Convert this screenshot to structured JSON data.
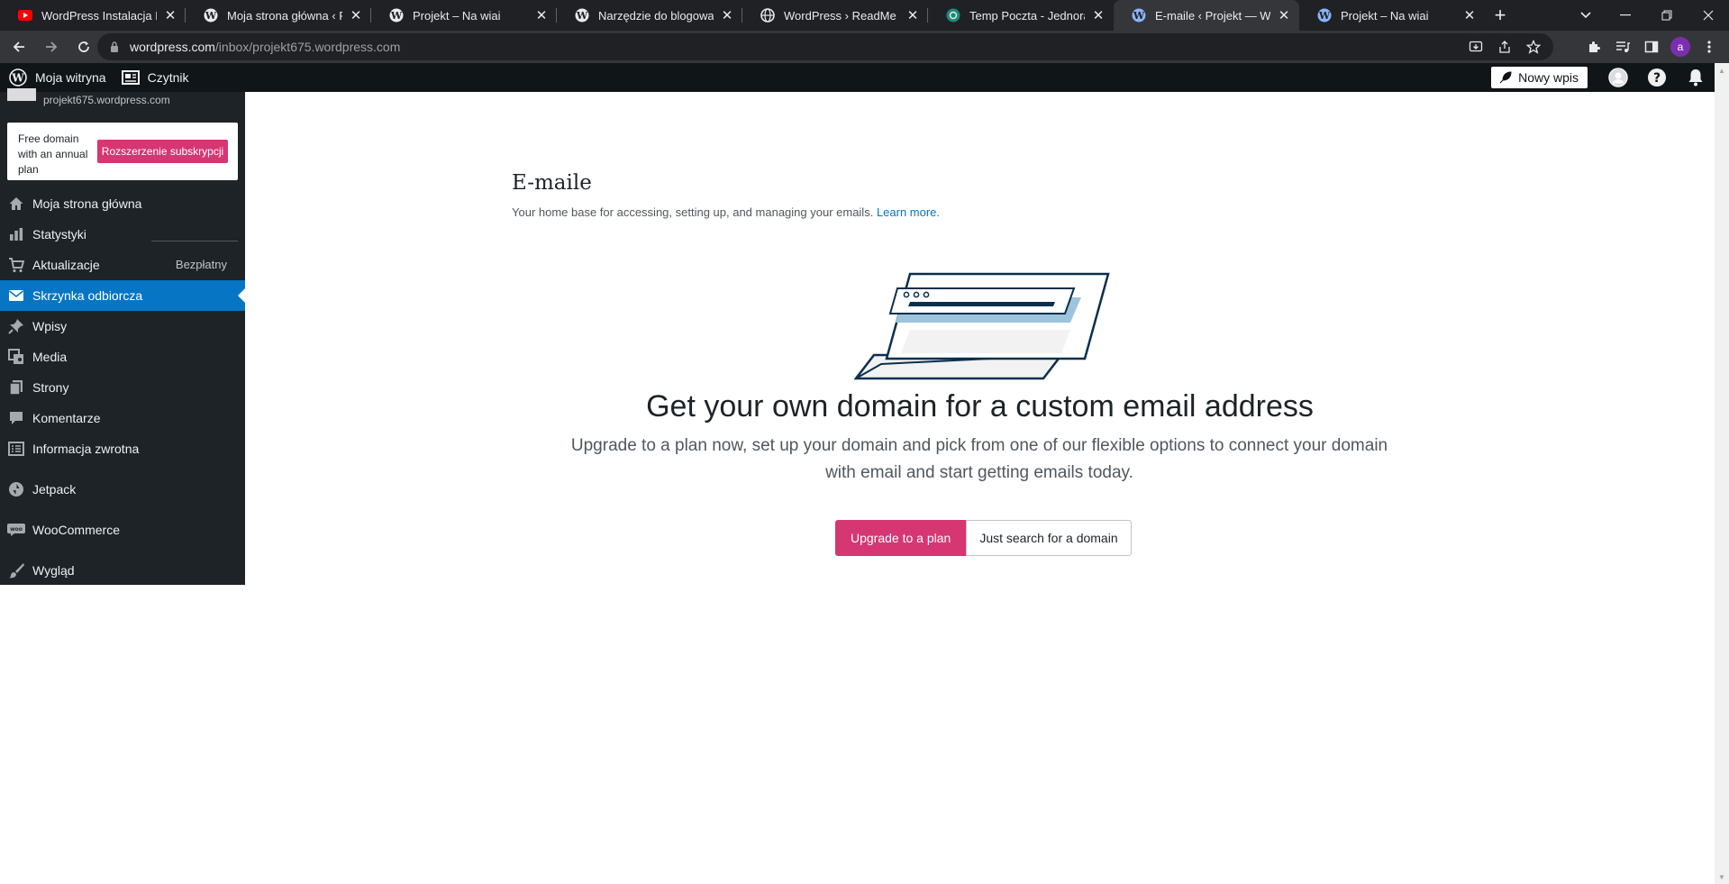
{
  "browser": {
    "tabs": [
      {
        "title": "WordPress Instalacja Porad",
        "favicon": "youtube-icon"
      },
      {
        "title": "Moja strona główna ‹ Proje",
        "favicon": "wordpress-icon"
      },
      {
        "title": "Projekt – Na wiai",
        "favicon": "wordpress-icon"
      },
      {
        "title": "Narzędzie do blogowania,",
        "favicon": "wordpress-icon"
      },
      {
        "title": "WordPress › ReadMe",
        "favicon": "globe-icon"
      },
      {
        "title": "Temp Poczta - Jednorazow",
        "favicon": "tempmail-icon"
      },
      {
        "title": "E-maile ‹ Projekt — WordP",
        "favicon": "wordpress-icon",
        "active": true
      },
      {
        "title": "Projekt – Na wiai",
        "favicon": "wordpress-icon"
      }
    ],
    "url_domain": "wordpress.com",
    "url_path": "/inbox/projekt675.wordpress.com",
    "profile_initial": "a"
  },
  "adminbar": {
    "my_site": "Moja witryna",
    "reader": "Czytnik",
    "new_post": "Nowy wpis"
  },
  "sidebar": {
    "site_url": "projekt675.wordpress.com",
    "upsell_text": "Free domain with an annual plan",
    "upsell_button": "Rozszerzenie subskrypcji",
    "items": [
      {
        "label": "Moja strona główna",
        "icon": "home-icon"
      },
      {
        "label": "Statystyki",
        "icon": "stats-icon"
      },
      {
        "label": "Aktualizacje",
        "icon": "cart-icon",
        "badge": "Bezpłatny"
      },
      {
        "label": "Skrzynka odbiorcza",
        "icon": "mail-icon",
        "active": true
      },
      {
        "label": "Wpisy",
        "icon": "pin-icon"
      },
      {
        "label": "Media",
        "icon": "media-icon"
      },
      {
        "label": "Strony",
        "icon": "pages-icon"
      },
      {
        "label": "Komentarze",
        "icon": "comment-icon"
      },
      {
        "label": "Informacja zwrotna",
        "icon": "feedback-icon"
      },
      {
        "label": "Jetpack",
        "icon": "jetpack-icon"
      },
      {
        "label": "WooCommerce",
        "icon": "woo-icon"
      },
      {
        "label": "Wygląd",
        "icon": "brush-icon"
      }
    ]
  },
  "main": {
    "title": "E-maile",
    "subtitle": "Your home base for accessing, setting up, and managing your emails.",
    "learn_more": "Learn more.",
    "promo_title": "Get your own domain for a custom email address",
    "promo_body": "Upgrade to a plan now, set up your domain and pick from one of our flexible options to connect your domain with email and start getting emails today.",
    "primary_button": "Upgrade to a plan",
    "secondary_button": "Just search for a domain"
  },
  "colors": {
    "accent_pink": "#d63672",
    "active_blue": "#0675c4",
    "sidebar_bg": "#1d2327",
    "adminbar_bg": "#101517"
  }
}
